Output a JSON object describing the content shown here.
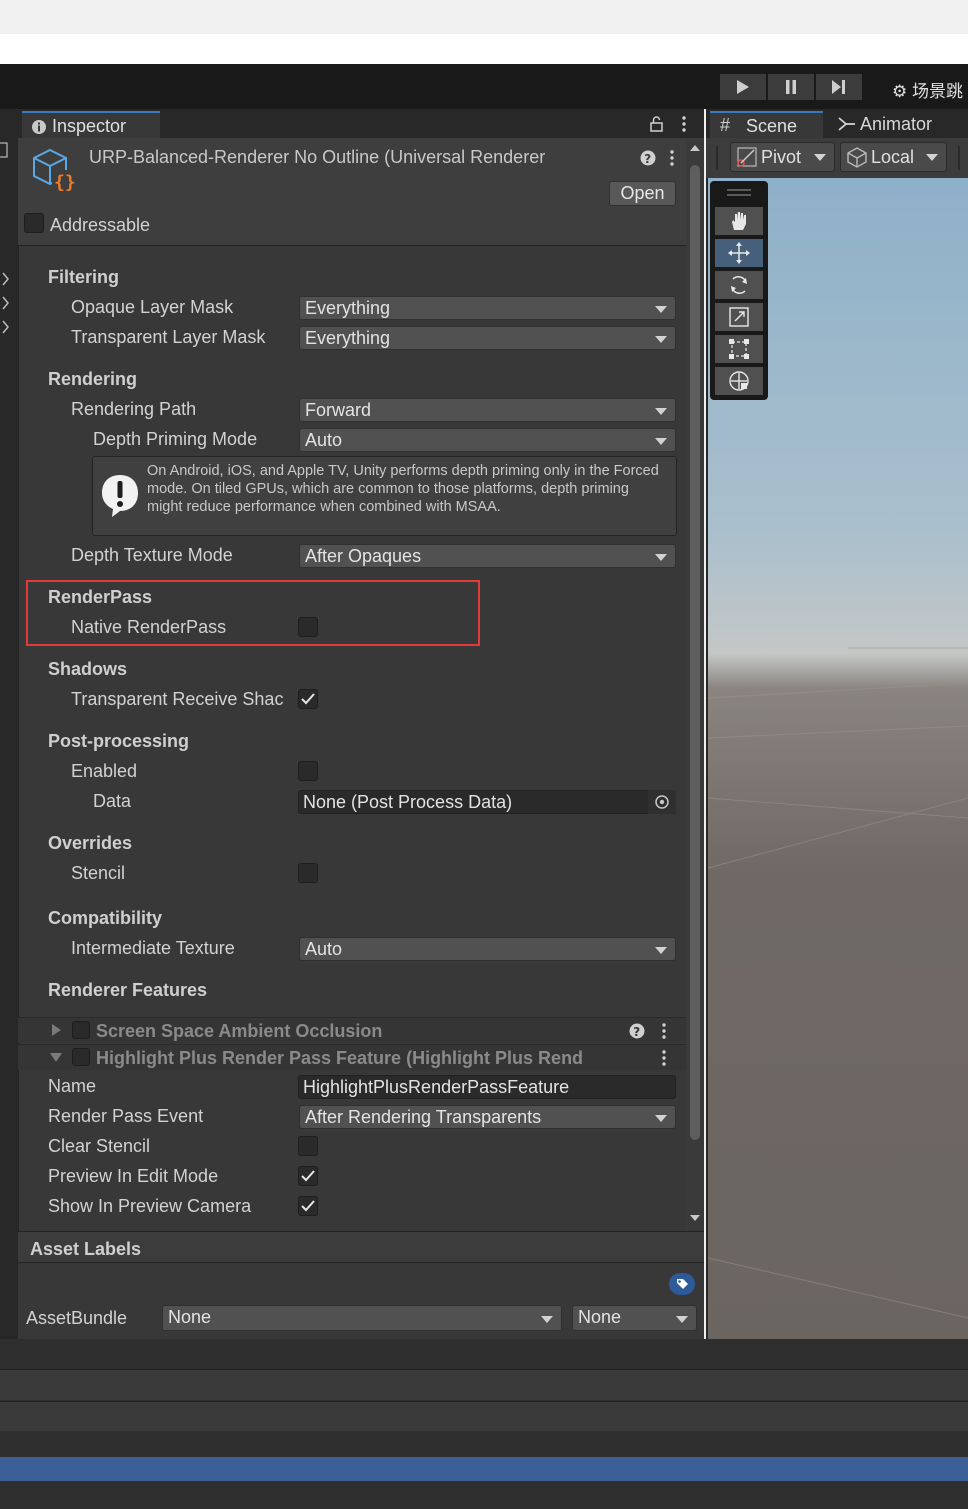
{
  "toolbar": {
    "scene_label": "场景跳"
  },
  "inspector": {
    "tab_label": "Inspector",
    "title": "URP-Balanced-Renderer No Outline (Universal Renderer",
    "open_label": "Open",
    "addressable_label": "Addressable",
    "filtering": {
      "header": "Filtering",
      "opaque_label": "Opaque Layer Mask",
      "opaque_value": "Everything",
      "transparent_label": "Transparent Layer Mask",
      "transparent_value": "Everything"
    },
    "rendering": {
      "header": "Rendering",
      "path_label": "Rendering Path",
      "path_value": "Forward",
      "depth_priming_label": "Depth Priming Mode",
      "depth_priming_value": "Auto",
      "help_text": "On Android, iOS, and Apple TV, Unity performs depth priming only in the Forced mode. On tiled GPUs, which are common to those platforms, depth priming might reduce performance when combined with MSAA.",
      "depth_texture_label": "Depth Texture Mode",
      "depth_texture_value": "After Opaques"
    },
    "renderpass": {
      "header": "RenderPass",
      "native_label": "Native RenderPass",
      "native_checked": false
    },
    "shadows": {
      "header": "Shadows",
      "receive_label": "Transparent Receive Shac",
      "receive_checked": true
    },
    "post": {
      "header": "Post-processing",
      "enabled_label": "Enabled",
      "enabled_checked": false,
      "data_label": "Data",
      "data_value": "None (Post Process Data)"
    },
    "overrides": {
      "header": "Overrides",
      "stencil_label": "Stencil",
      "stencil_checked": false
    },
    "compat": {
      "header": "Compatibility",
      "intermediate_label": "Intermediate Texture",
      "intermediate_value": "Auto"
    },
    "features": {
      "header": "Renderer Features",
      "ssao_label": "Screen Space Ambient Occlusion",
      "highlight_label": "Highlight Plus Render Pass Feature (Highlight Plus Rend",
      "name_label": "Name",
      "name_value": "HighlightPlusRenderPassFeature",
      "event_label": "Render Pass Event",
      "event_value": "After Rendering Transparents",
      "clear_stencil_label": "Clear Stencil",
      "clear_stencil_checked": false,
      "preview_label": "Preview In Edit Mode",
      "preview_checked": true,
      "show_camera_label": "Show In Preview Camera",
      "show_camera_checked": true
    },
    "asset_labels": {
      "header": "Asset Labels",
      "bundle_label": "AssetBundle",
      "bundle_value": "None",
      "variant_value": "None"
    }
  },
  "scene": {
    "scene_tab": "Scene",
    "animator_tab": "Animator",
    "pivot_label": "Pivot",
    "local_label": "Local"
  },
  "colors": {
    "highlight_box": "#e03a3a",
    "accent": "#3a79bb"
  }
}
